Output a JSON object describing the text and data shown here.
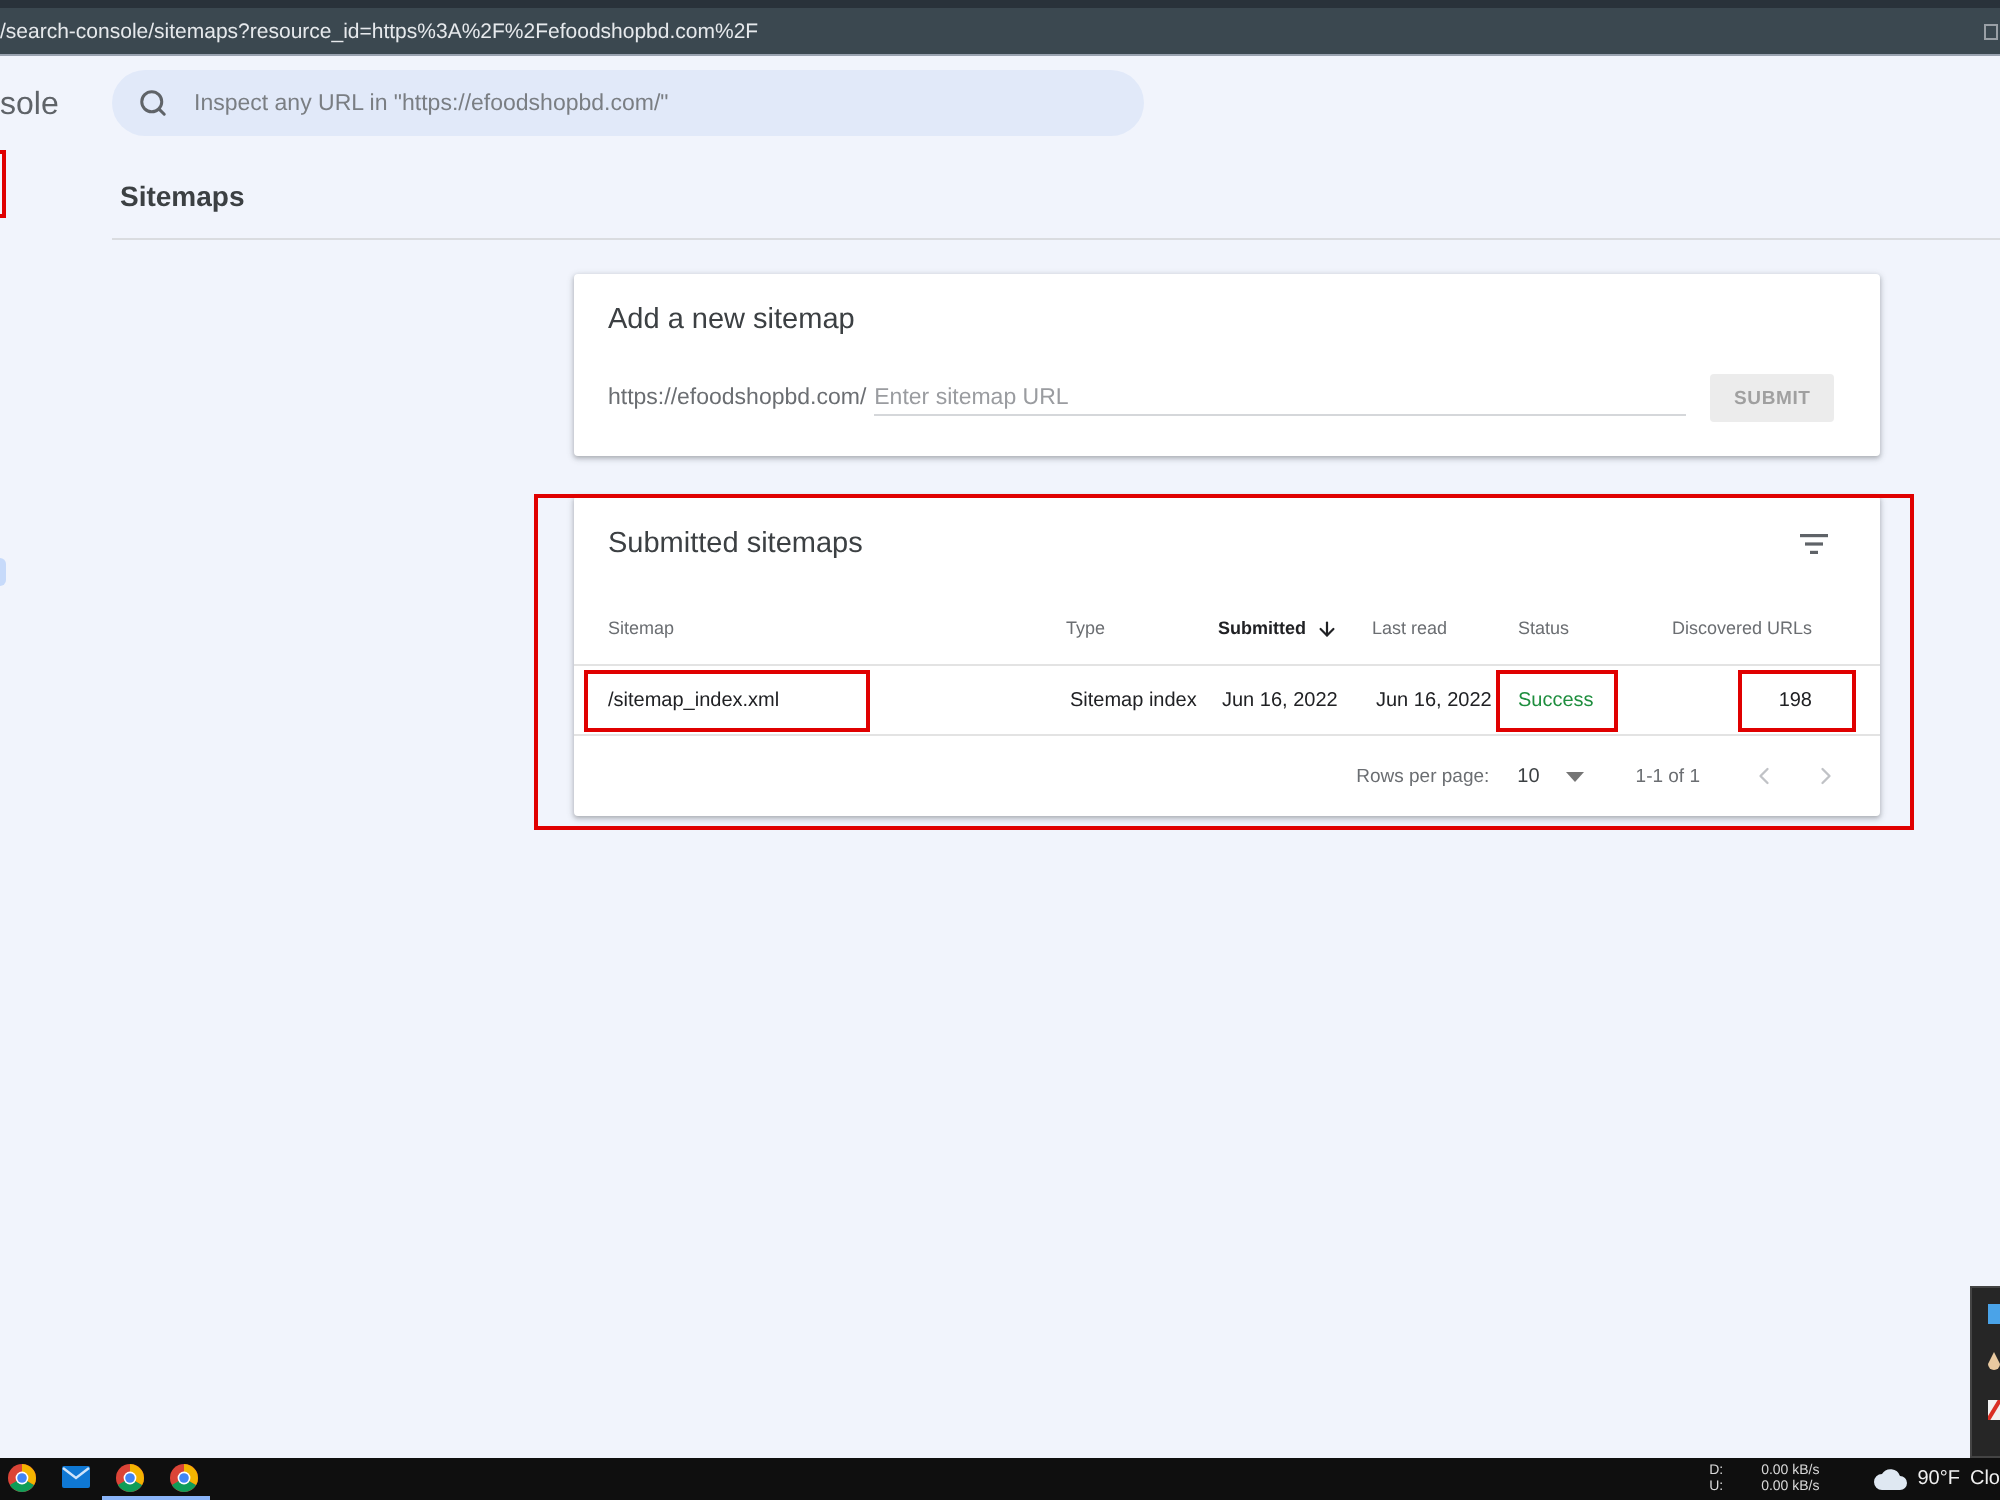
{
  "browser": {
    "url": "/search-console/sitemaps?resource_id=https%3A%2F%2Fefoodshopbd.com%2F"
  },
  "sidebar": {
    "logo_text": "sole",
    "highlighted": true
  },
  "search": {
    "placeholder": "Inspect any URL in \"https://efoodshopbd.com/\""
  },
  "page_title": "Sitemaps",
  "add_sitemap": {
    "title": "Add a new sitemap",
    "prefix": "https://efoodshopbd.com/",
    "placeholder": "Enter sitemap URL",
    "submit": {
      "label": "SUBMIT",
      "disabled": true
    }
  },
  "submitted": {
    "title": "Submitted sitemaps",
    "highlighted": true,
    "columns": [
      {
        "label": "Sitemap",
        "sorted": false
      },
      {
        "label": "Type",
        "sorted": false
      },
      {
        "label": "Submitted",
        "sorted": true
      },
      {
        "label": "Last read",
        "sorted": false
      },
      {
        "label": "Status",
        "sorted": false
      },
      {
        "label": "Discovered URLs",
        "sorted": false
      }
    ],
    "rows": [
      {
        "cells": [
          {
            "kind": "path",
            "text": "/sitemap_index.xml",
            "highlighted": true
          },
          {
            "kind": "text",
            "text": "Sitemap index",
            "highlighted": false
          },
          {
            "kind": "text",
            "text": "Jun 16, 2022",
            "highlighted": false
          },
          {
            "kind": "text",
            "text": "Jun 16, 2022",
            "highlighted": false
          },
          {
            "kind": "status",
            "text": "Success",
            "highlighted": true
          },
          {
            "kind": "number",
            "text": "198",
            "highlighted": true
          }
        ]
      }
    ],
    "pagination": {
      "rows_per_page_label": "Rows per page:",
      "rows_per_page": "10",
      "range": "1-1 of 1",
      "prev_disabled": true,
      "next_disabled": true
    }
  },
  "taskbar": {
    "apps": [
      {
        "kind": "browser",
        "open": false
      },
      {
        "kind": "mail",
        "open": false
      },
      {
        "kind": "browser",
        "open": true
      },
      {
        "kind": "browser",
        "open": true
      }
    ],
    "net": [
      {
        "label": "D:",
        "value": "0.00 kB/s"
      },
      {
        "label": "U:",
        "value": "0.00 kB/s"
      }
    ],
    "weather": {
      "temp": "90°F",
      "text": "Clo"
    }
  }
}
